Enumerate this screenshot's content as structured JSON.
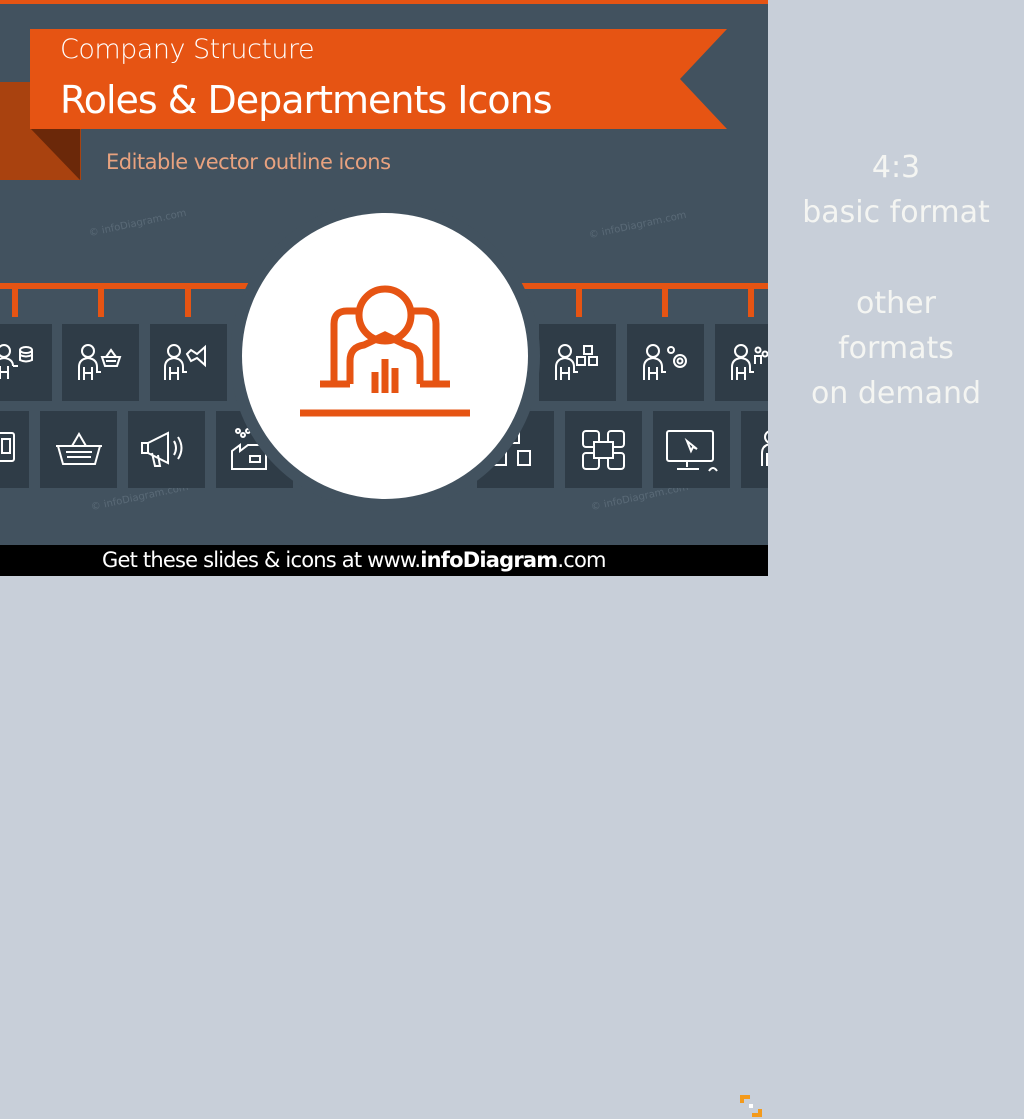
{
  "slide": {
    "title_line1": "Company Structure",
    "title_line2": "Roles & Departments Icons",
    "subtitle": "Editable vector outline icons",
    "watermark": "© infoDiagram.com",
    "featured_icon": "manager-with-chart-icon",
    "top_row_icons": [
      "finance-manager-icon",
      "purchasing-manager-icon",
      "marketing-manager-icon",
      "logistics-manager-icon",
      "operations-manager-icon",
      "hr-manager-icon"
    ],
    "bottom_row_icons": [
      "safe-icon",
      "shopping-basket-icon",
      "megaphone-icon",
      "factory-icon",
      "boxes-icon",
      "network-structure-icon",
      "computer-screen-icon",
      "person-icon"
    ]
  },
  "footer": {
    "prefix": "Get these slides & icons at www.",
    "brand": "infoDiagram",
    "suffix": ".com"
  },
  "side_panel": {
    "line1": "4:3",
    "line2": "basic format",
    "line3": "other",
    "line4": "formats",
    "line5": "on demand"
  },
  "colors": {
    "accent": "#e65413",
    "background": "#42525f",
    "tile": "#2f3c47",
    "side_panel": "#c8cfd9"
  }
}
